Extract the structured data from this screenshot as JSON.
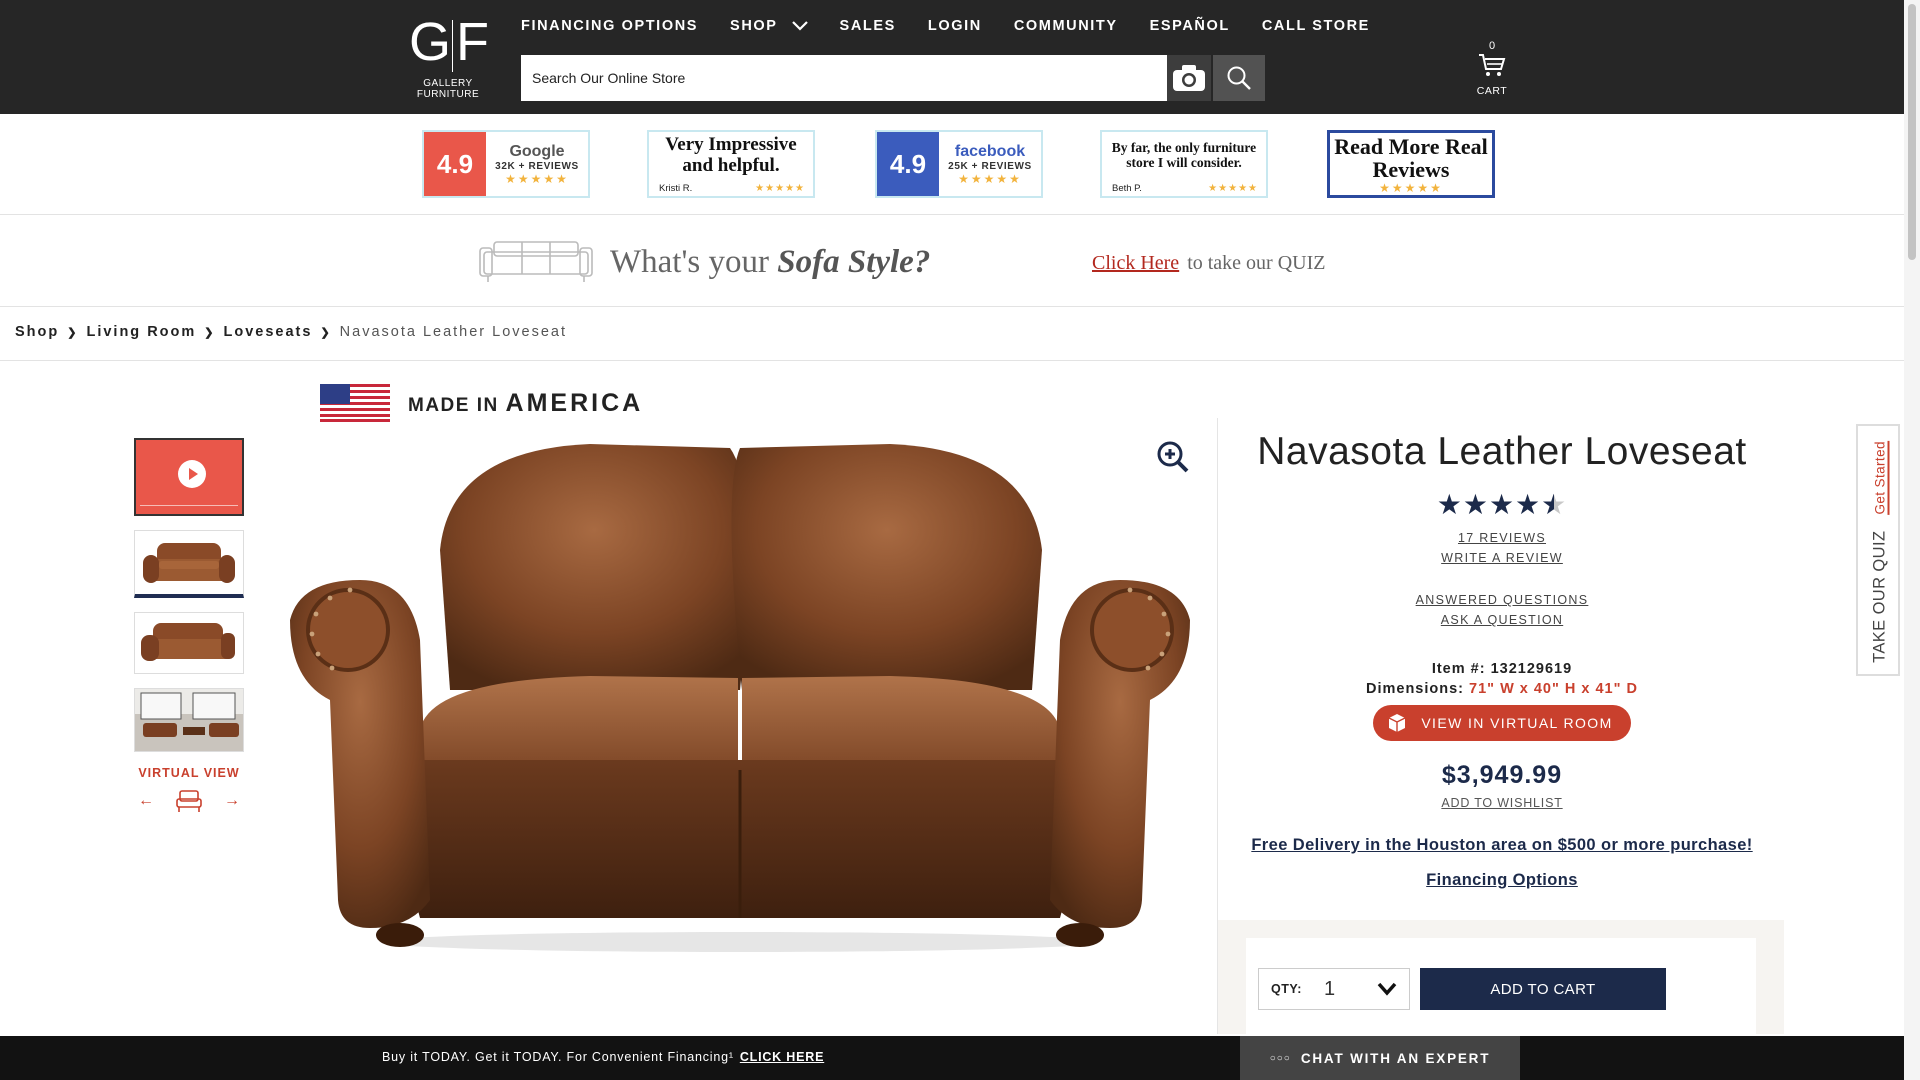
{
  "header": {
    "logo_mark_left": "G",
    "logo_mark_right": "F",
    "logo_text": "GALLERY FURNITURE",
    "nav": [
      "FINANCING OPTIONS",
      "SHOP",
      "SALES",
      "LOGIN",
      "COMMUNITY",
      "ESPAÑOL",
      "CALL STORE"
    ],
    "search_placeholder": "Search Our Online Store",
    "cart_count": "0",
    "cart_label": "CART"
  },
  "badges": {
    "google": {
      "score": "4.9",
      "name": "Google",
      "count": "32K + REVIEWS",
      "stars": "★★★★★"
    },
    "quote1": {
      "text": "Very Impressive and helpful.",
      "author": "Kristi R.",
      "stars": "★★★★★"
    },
    "facebook": {
      "score": "4.9",
      "name": "facebook",
      "count": "25K + REVIEWS",
      "stars": "★★★★★"
    },
    "quote2": {
      "text": "By far, the only furniture store I will consider.",
      "author": "Beth P.",
      "stars": "★★★★★"
    },
    "more": {
      "text": "Read More Real Reviews",
      "stars": "★★★★★"
    }
  },
  "quiz_banner": {
    "question_prefix": "What's your",
    "question_emph": "Sofa Style?",
    "link": "Click Here",
    "suffix": "to take our QUIZ"
  },
  "breadcrumb": {
    "items": [
      "Shop",
      "Living Room",
      "Loveseats"
    ],
    "current": "Navasota Leather Loveseat"
  },
  "made_in": {
    "prefix": "MADE IN",
    "country": "AMERICA"
  },
  "gallery": {
    "virtual_view_label": "VIRTUAL VIEW",
    "prev": "←",
    "next": "→"
  },
  "product": {
    "title": "Navasota Leather Loveseat",
    "rating": 4.5,
    "stars_full": "★★★★",
    "stars_half": "★",
    "reviews_link": "17 REVIEWS",
    "write_review": "WRITE A REVIEW",
    "answered_questions": "ANSWERED QUESTIONS",
    "ask_question": "ASK A QUESTION",
    "item_label": "Item #:",
    "item_number": "132129619",
    "dims_label": "Dimensions:",
    "dims_value": "71\" W x 40\" H x 41\" D",
    "virtual_room": "VIEW IN VIRTUAL ROOM",
    "price": "$3,949.99",
    "wishlist": "ADD TO WISHLIST",
    "delivery": "Free Delivery in the Houston area on $500 or more purchase!",
    "financing": "Financing Options",
    "qty_label": "QTY:",
    "qty_value": "1",
    "add_to_cart": "ADD TO CART"
  },
  "side_tab": {
    "label": "TAKE OUR QUIZ",
    "cta": "Get Started"
  },
  "bottom_bar": {
    "promo": "Buy it TODAY. Get it TODAY. For Convenient Financing¹",
    "promo_link": "CLICK HERE",
    "chat": "CHAT WITH AN EXPERT"
  },
  "colors": {
    "header_bg": "#262626",
    "accent_red": "#c9402d",
    "navy": "#1c2a4a",
    "google_score_bg": "#e9574a",
    "facebook_score_bg": "#3b5cbd"
  }
}
